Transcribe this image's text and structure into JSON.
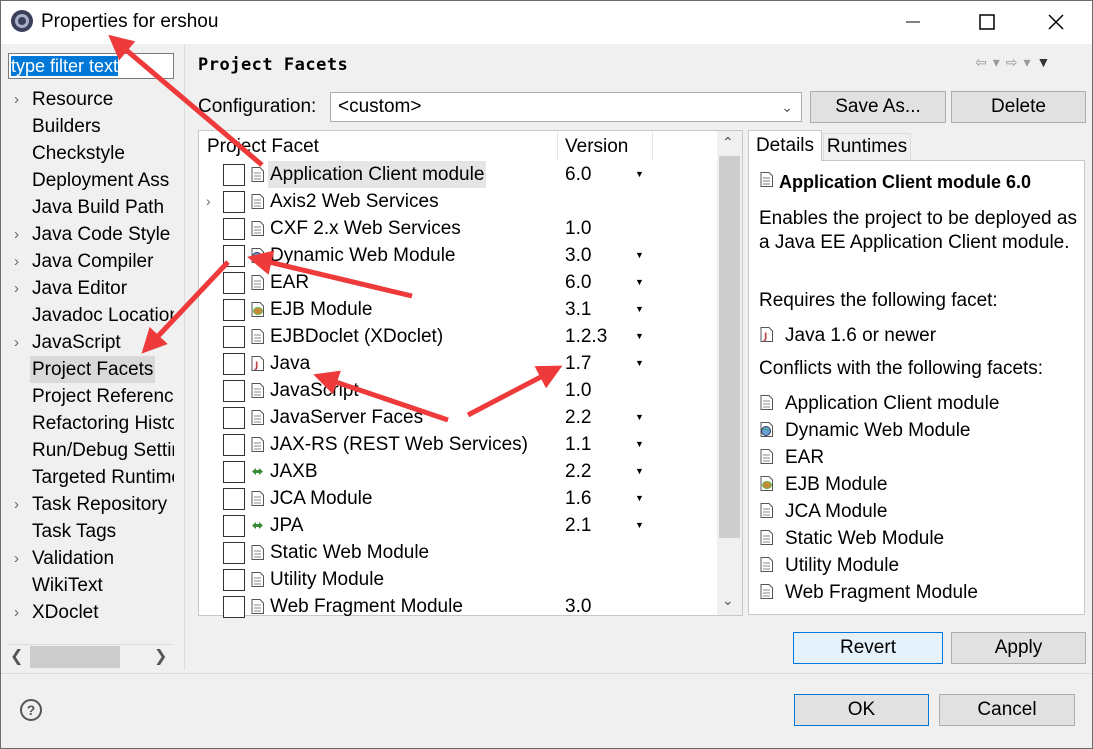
{
  "window": {
    "title": "Properties for ershou",
    "icons": [
      "app-gear-icon",
      "minimize-icon",
      "maximize-icon",
      "close-icon"
    ]
  },
  "filter": {
    "value": "type filter text"
  },
  "nav": {
    "items": [
      {
        "label": "Resource",
        "expandable": true
      },
      {
        "label": "Builders",
        "expandable": false
      },
      {
        "label": "Checkstyle",
        "expandable": false
      },
      {
        "label": "Deployment Ass",
        "expandable": false
      },
      {
        "label": "Java Build Path",
        "expandable": false
      },
      {
        "label": "Java Code Style",
        "expandable": true
      },
      {
        "label": "Java Compiler",
        "expandable": true
      },
      {
        "label": "Java Editor",
        "expandable": true
      },
      {
        "label": "Javadoc Location",
        "expandable": false
      },
      {
        "label": "JavaScript",
        "expandable": true
      },
      {
        "label": "Project Facets",
        "expandable": false,
        "selected": true
      },
      {
        "label": "Project References",
        "expandable": false
      },
      {
        "label": "Refactoring History",
        "expandable": false
      },
      {
        "label": "Run/Debug Settings",
        "expandable": false
      },
      {
        "label": "Targeted Runtimes",
        "expandable": false
      },
      {
        "label": "Task Repository",
        "expandable": true
      },
      {
        "label": "Task Tags",
        "expandable": false
      },
      {
        "label": "Validation",
        "expandable": true
      },
      {
        "label": "WikiText",
        "expandable": false
      },
      {
        "label": "XDoclet",
        "expandable": true
      }
    ]
  },
  "page": {
    "title": "Project Facets"
  },
  "config": {
    "label": "Configuration:",
    "value": "<custom>",
    "save_as": "Save As...",
    "delete": "Delete"
  },
  "table": {
    "col_facet": "Project Facet",
    "col_version": "Version",
    "rows": [
      {
        "name": "Application Client module",
        "version": "6.0",
        "dropdown": true,
        "icon": "page-icon",
        "selected": true
      },
      {
        "name": "Axis2 Web Services",
        "version": "",
        "dropdown": false,
        "icon": "page-icon",
        "expandable": true
      },
      {
        "name": "CXF 2.x Web Services",
        "version": "1.0",
        "dropdown": false,
        "icon": "page-icon"
      },
      {
        "name": "Dynamic Web Module",
        "version": "3.0",
        "dropdown": true,
        "icon": "globe-icon"
      },
      {
        "name": "EAR",
        "version": "6.0",
        "dropdown": true,
        "icon": "page-icon"
      },
      {
        "name": "EJB Module",
        "version": "3.1",
        "dropdown": true,
        "icon": "bean-icon"
      },
      {
        "name": "EJBDoclet (XDoclet)",
        "version": "1.2.3",
        "dropdown": true,
        "icon": "page-icon"
      },
      {
        "name": "Java",
        "version": "1.7",
        "dropdown": true,
        "icon": "java-icon"
      },
      {
        "name": "JavaScript",
        "version": "1.0",
        "dropdown": false,
        "icon": "page-icon"
      },
      {
        "name": "JavaServer Faces",
        "version": "2.2",
        "dropdown": true,
        "icon": "page-icon"
      },
      {
        "name": "JAX-RS (REST Web Services)",
        "version": "1.1",
        "dropdown": true,
        "icon": "page-icon"
      },
      {
        "name": "JAXB",
        "version": "2.2",
        "dropdown": true,
        "icon": "arrows-icon"
      },
      {
        "name": "JCA Module",
        "version": "1.6",
        "dropdown": true,
        "icon": "page-icon"
      },
      {
        "name": "JPA",
        "version": "2.1",
        "dropdown": true,
        "icon": "arrows-icon"
      },
      {
        "name": "Static Web Module",
        "version": "",
        "dropdown": false,
        "icon": "page-icon"
      },
      {
        "name": "Utility Module",
        "version": "",
        "dropdown": false,
        "icon": "page-icon"
      },
      {
        "name": "Web Fragment Module",
        "version": "3.0",
        "dropdown": false,
        "icon": "page-icon"
      }
    ]
  },
  "details": {
    "tab_details": "Details",
    "tab_runtimes": "Runtimes",
    "title": "Application Client module 6.0",
    "description": "Enables the project to be deployed as a Java EE Application Client module.",
    "requires_label": "Requires the following facet:",
    "requires": [
      {
        "label": "Java 1.6 or newer",
        "icon": "java-icon"
      }
    ],
    "conflicts_label": "Conflicts with the following facets:",
    "conflicts": [
      {
        "label": "Application Client module",
        "icon": "page-icon"
      },
      {
        "label": "Dynamic Web Module",
        "icon": "globe-icon"
      },
      {
        "label": "EAR",
        "icon": "page-icon"
      },
      {
        "label": "EJB Module",
        "icon": "bean-icon"
      },
      {
        "label": "JCA Module",
        "icon": "page-icon"
      },
      {
        "label": "Static Web Module",
        "icon": "page-icon"
      },
      {
        "label": "Utility Module",
        "icon": "page-icon"
      },
      {
        "label": "Web Fragment Module",
        "icon": "page-icon"
      }
    ]
  },
  "buttons": {
    "revert": "Revert",
    "apply": "Apply",
    "ok": "OK",
    "cancel": "Cancel",
    "help_glyph": "?"
  },
  "annotation_color": "#ee3a3a"
}
